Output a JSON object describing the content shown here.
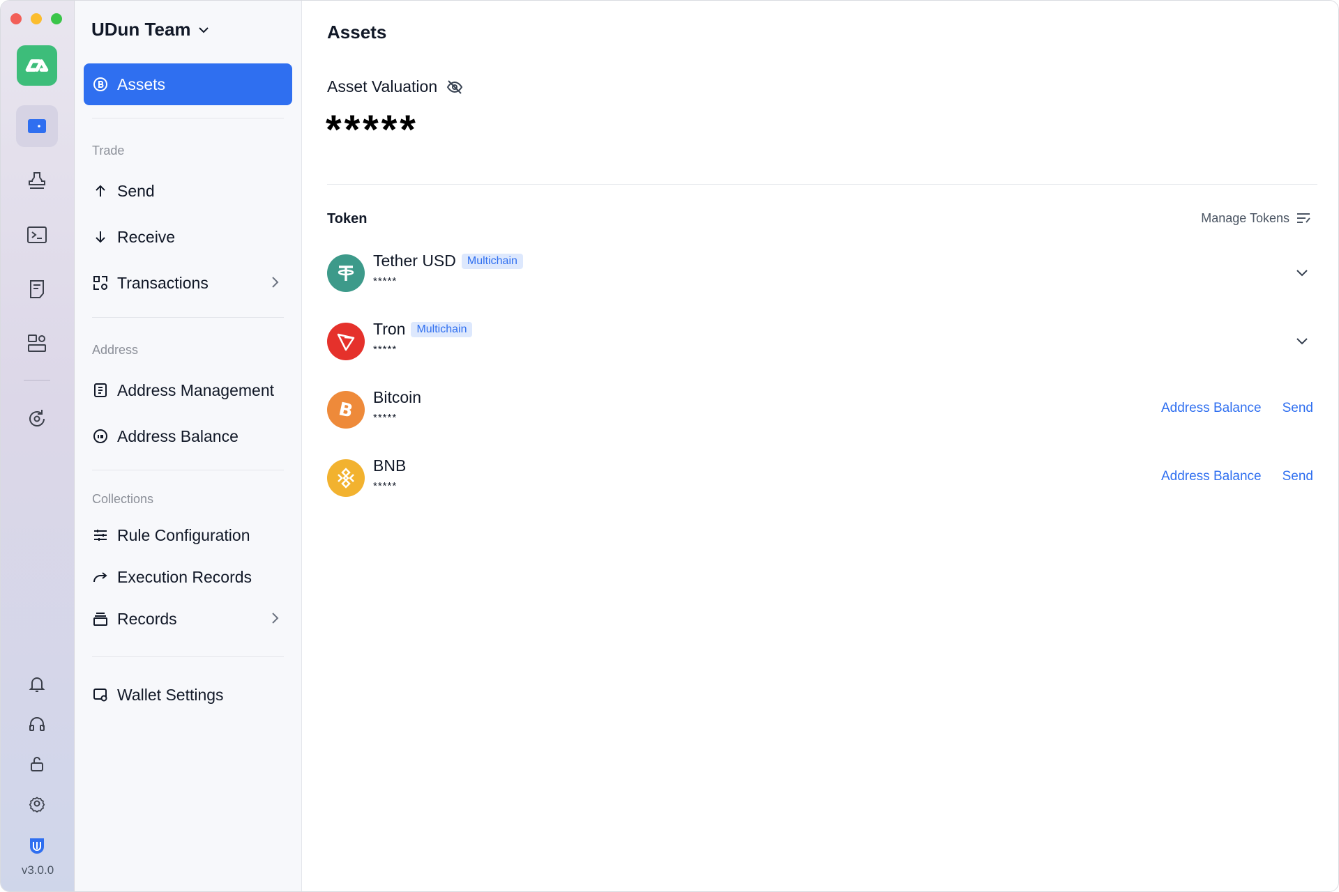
{
  "rail": {
    "version": "v3.0.0",
    "items": [
      {
        "icon": "wallet-icon"
      },
      {
        "icon": "stamp-icon"
      },
      {
        "icon": "terminal-icon"
      },
      {
        "icon": "receipt-icon"
      },
      {
        "icon": "dashboard-settings-icon"
      },
      {
        "icon": "sync-settings-icon"
      }
    ],
    "bottom": [
      {
        "icon": "bell-icon"
      },
      {
        "icon": "headphones-icon"
      },
      {
        "icon": "unlock-icon"
      },
      {
        "icon": "gear-icon"
      },
      {
        "icon": "shield-logo-icon"
      }
    ]
  },
  "nav": {
    "team": "UDun Team",
    "assets_label": "Assets",
    "trade_section": "Trade",
    "send_label": "Send",
    "receive_label": "Receive",
    "transactions_label": "Transactions",
    "address_section": "Address",
    "address_management_label": "Address Management",
    "address_balance_label": "Address Balance",
    "collections_section": "Collections",
    "rule_configuration_label": "Rule Configuration",
    "execution_records_label": "Execution Records",
    "records_label": "Records",
    "wallet_settings_label": "Wallet Settings"
  },
  "main": {
    "title": "Assets",
    "valuation_label": "Asset Valuation",
    "valuation_value": "*****",
    "token_header": "Token",
    "manage_tokens": "Manage Tokens",
    "tokens": [
      {
        "name": "Tether USD",
        "badge": "Multichain",
        "amount": "*****",
        "color": "#3d9a8a"
      },
      {
        "name": "Tron",
        "badge": "Multichain",
        "amount": "*****",
        "color": "#e5312b"
      },
      {
        "name": "Bitcoin",
        "amount": "*****",
        "color": "#ee8a3a",
        "action_balance": "Address Balance",
        "action_send": "Send"
      },
      {
        "name": "BNB",
        "amount": "*****",
        "color": "#f2b22f",
        "action_balance": "Address Balance",
        "action_send": "Send"
      }
    ]
  },
  "colors": {
    "accent": "#2f6ff0",
    "app_logo": "#3dbd7a"
  }
}
